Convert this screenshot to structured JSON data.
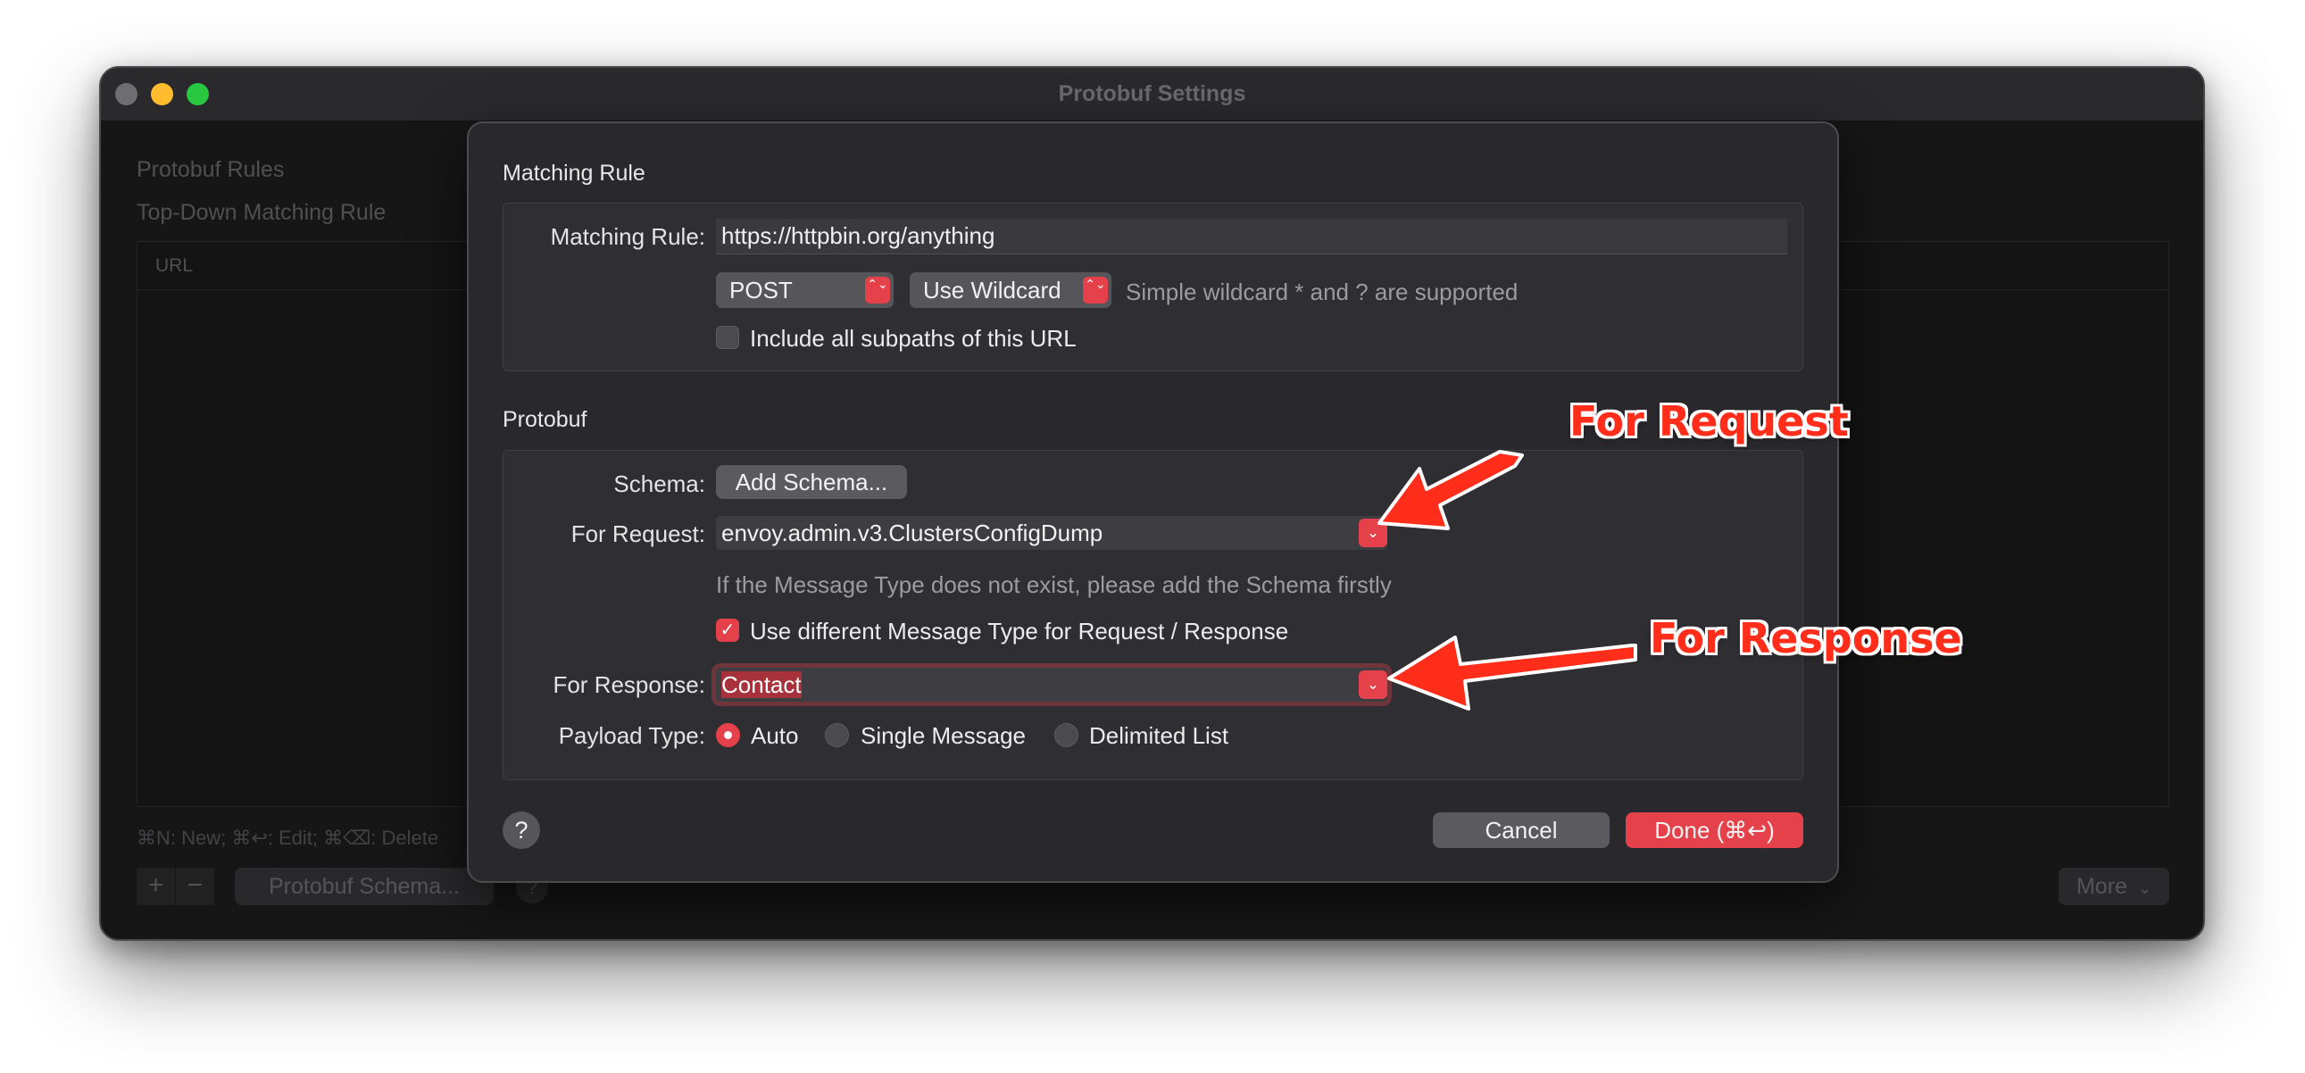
{
  "window": {
    "title": "Protobuf Settings",
    "background": {
      "rules_title": "Protobuf Rules",
      "matching_subtitle": "Top-Down Matching Rule",
      "column_url": "URL",
      "shortcuts": "⌘N: New; ⌘↩: Edit; ⌘⌫: Delete",
      "add_symbol": "+",
      "remove_symbol": "−",
      "schema_button": "Protobuf Schema...",
      "help_symbol": "?",
      "more_button": "More",
      "more_chevron": "⌄"
    }
  },
  "sheet": {
    "matching_section": {
      "title": "Matching Rule",
      "rule_label": "Matching Rule:",
      "rule_value": "https://httpbin.org/anything",
      "method_value": "POST",
      "wildcard_value": "Use Wildcard",
      "wildcard_hint": "Simple wildcard * and ? are supported",
      "subpaths_label": "Include all subpaths of this URL",
      "subpaths_checked": false,
      "popup_arrow_glyph": "⌃⌄"
    },
    "protobuf_section": {
      "title": "Protobuf",
      "schema_label": "Schema:",
      "add_schema_button": "Add Schema...",
      "request_label": "For Request:",
      "request_value": "envoy.admin.v3.ClustersConfigDump",
      "request_hint": "If the Message Type does not exist, please add the Schema firstly",
      "different_type_label": "Use different Message Type for Request / Response",
      "different_type_checked": true,
      "check_glyph": "✓",
      "combo_arrow_glyph": "⌄",
      "response_label": "For Response:",
      "response_value": "Contact",
      "payload_label": "Payload Type:",
      "payload_options": [
        "Auto",
        "Single Message",
        "Delimited List"
      ],
      "payload_selected": "Auto"
    },
    "footer": {
      "help_symbol": "?",
      "cancel_button": "Cancel",
      "done_button": "Done (⌘↩)"
    }
  },
  "annotations": {
    "request_callout": "For Request",
    "response_callout": "For Response",
    "color": "#ff2d1a"
  },
  "colors": {
    "accent": "#e5414a",
    "window_bg": "#1f1f21",
    "sheet_bg": "#29292d"
  }
}
